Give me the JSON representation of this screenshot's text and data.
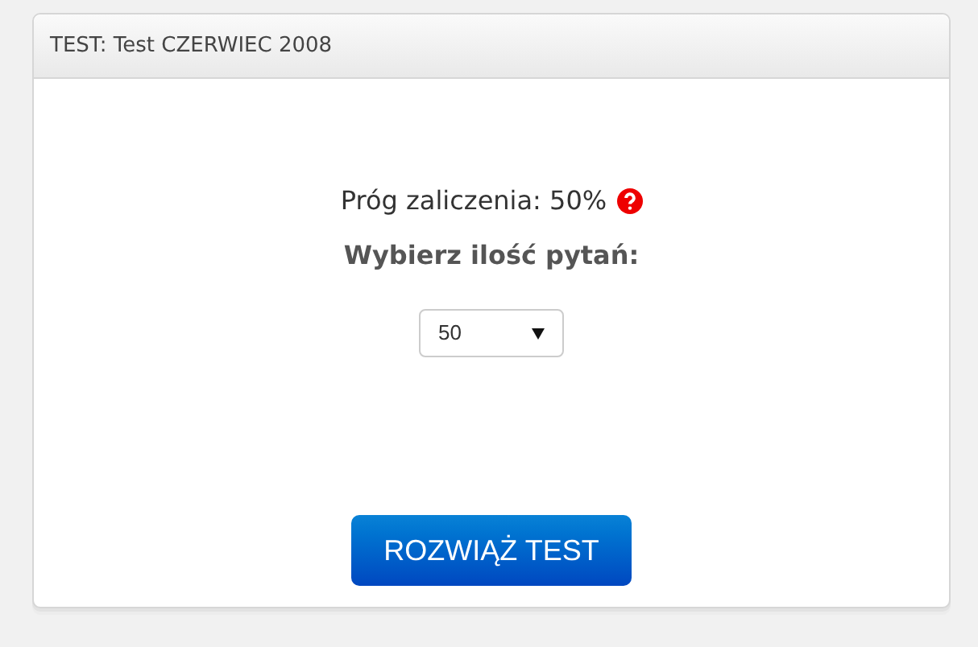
{
  "panel": {
    "title": "TEST: Test CZERWIEC 2008"
  },
  "pass_threshold": "Próg zaliczenia: 50%",
  "question_count_label": "Wybierz ilość pytań:",
  "question_count_select": {
    "value": "50"
  },
  "start_button": "ROZWIĄŻ TEST"
}
